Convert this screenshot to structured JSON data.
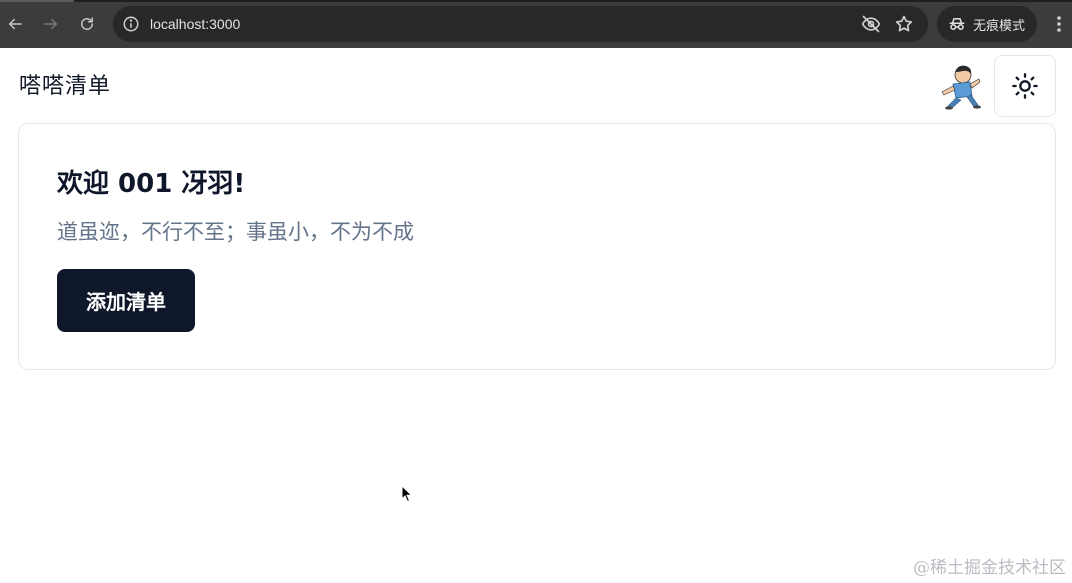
{
  "browser": {
    "url": "localhost:3000",
    "incognito_label": "无痕模式",
    "icons": {
      "back": "arrow-left-icon",
      "forward": "arrow-right-icon",
      "reload": "reload-icon",
      "site_info": "info-icon",
      "hide": "eye-off-icon",
      "bookmark": "star-icon",
      "incognito": "incognito-icon",
      "menu": "more-vertical-icon"
    }
  },
  "app": {
    "title": "嗒嗒清单",
    "theme_toggle_icon": "sun-icon",
    "card": {
      "heading": "欢迎 001 冴羽!",
      "motto": "道虽迩，不行不至；事虽小，不为不成",
      "add_button_label": "添加清单"
    }
  },
  "watermark": "@稀土掘金技术社区",
  "colors": {
    "chrome_bg": "#3c3c3c",
    "omnibox_bg": "#282828",
    "primary_button": "#0f172a",
    "muted_text": "#64748b",
    "border": "#e5e7eb"
  }
}
